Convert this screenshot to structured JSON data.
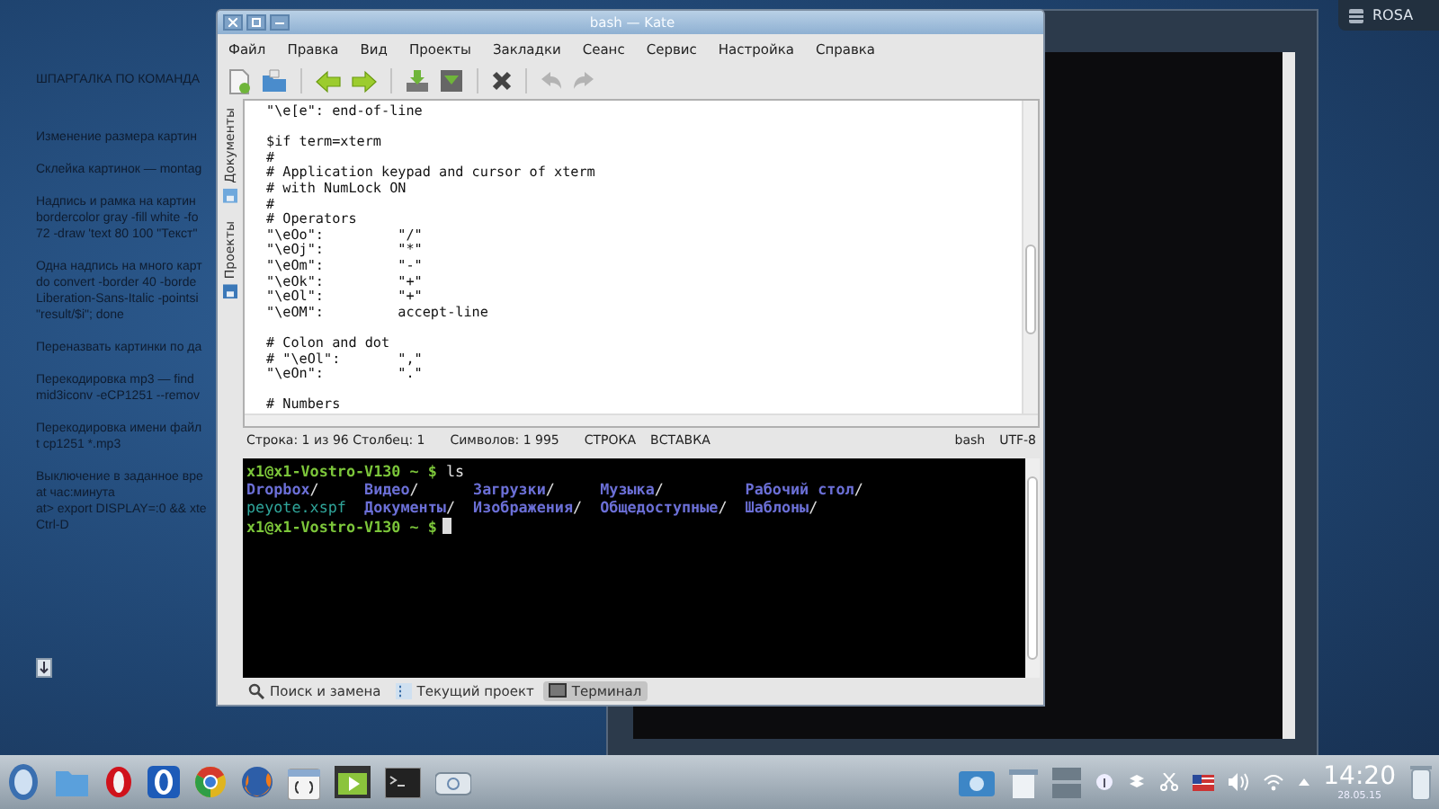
{
  "desktop": {
    "notes": [
      [
        "ШПАРГАЛКА ПО КОМАНДА"
      ],
      [
        "Изменение размера картин"
      ],
      [
        "Склейка картинок — montag"
      ],
      [
        "Надпись и рамка на картин",
        "bordercolor gray -fill white -fo",
        "72 -draw 'text 80 100 \"Текст\""
      ],
      [
        "Одна надпись на много карт",
        "do convert -border 40 -borde",
        "Liberation-Sans-Italic -pointsi",
        "\"result/$i\"; done"
      ],
      [
        "Переназвать картинки по да"
      ],
      [
        "Перекодировка mp3 — find",
        "mid3iconv -eCP1251 --remov"
      ],
      [
        "Перекодировка имени файл",
        "t cp1251 *.mp3"
      ],
      [
        "Выключение в заданное вре",
        "at час:минута",
        "at> export DISPLAY=:0 && xte",
        "Ctrl-D"
      ]
    ],
    "badge": "ROSA"
  },
  "kate": {
    "title": "bash — Kate",
    "menu": [
      "Файл",
      "Правка",
      "Вид",
      "Проекты",
      "Закладки",
      "Сеанс",
      "Сервис",
      "Настройка",
      "Справка"
    ],
    "toolbar": [
      {
        "kind": "new",
        "disabled": false
      },
      {
        "kind": "open",
        "disabled": false
      },
      {
        "kind": "separator"
      },
      {
        "kind": "back",
        "disabled": false
      },
      {
        "kind": "forward",
        "disabled": false
      },
      {
        "kind": "separator"
      },
      {
        "kind": "save",
        "disabled": false
      },
      {
        "kind": "save-as",
        "disabled": false
      },
      {
        "kind": "separator"
      },
      {
        "kind": "close",
        "disabled": false
      },
      {
        "kind": "separator"
      },
      {
        "kind": "undo",
        "disabled": true
      },
      {
        "kind": "redo",
        "disabled": true
      }
    ],
    "side_tabs": [
      {
        "label": "Документы",
        "selected": false
      },
      {
        "label": "Проекты",
        "selected": false
      }
    ],
    "editor": [
      [
        "\"\\e[e\": end-of-line"
      ],
      [
        "$if term=xterm",
        "#",
        "# Application keypad and cursor of xterm",
        "# with NumLock ON",
        "#",
        "# Operators",
        "\"\\eOo\":         \"/\"",
        "\"\\eOj\":         \"*\"",
        "\"\\eOm\":         \"-\"",
        "\"\\eOk\":         \"+\"",
        "\"\\eOl\":         \"+\"",
        "\"\\eOM\":         accept-line"
      ],
      [
        "# Colon and dot",
        "# \"\\eOl\":       \",\"",
        "\"\\eOn\":         \".\""
      ],
      [
        "# Numbers"
      ]
    ],
    "status": {
      "position": "Строка: 1 из 96 Столбец: 1",
      "chars": "Символов: 1 995",
      "modes": [
        "СТРОКА",
        "ВСТАВКА"
      ],
      "syntax": "bash",
      "encoding": "UTF-8"
    },
    "terminal": [
      {
        "kind": "command",
        "prompt": "x1@x1-Vostro-V130 ~ $",
        "command": "ls",
        "cursor": false
      },
      {
        "kind": "listing",
        "items": [
          {
            "name": "Dropbox",
            "suffix": "/",
            "color": "#6b6fd6"
          },
          {
            "name": "Видео",
            "suffix": "/",
            "color": "#6b6fd6"
          },
          {
            "name": "Загрузки",
            "suffix": "/",
            "color": "#6b6fd6"
          },
          {
            "name": "Музыка",
            "suffix": "/",
            "color": "#6b6fd6"
          },
          {
            "name": "Рабочий стол",
            "suffix": "/",
            "color": "#6b6fd6"
          }
        ]
      },
      {
        "kind": "listing",
        "items": [
          {
            "name": "peyote.xspf",
            "color": "#2fa59a"
          },
          {
            "name": "Документы",
            "suffix": "/",
            "color": "#6b6fd6"
          },
          {
            "name": "Изображения",
            "suffix": "/",
            "color": "#6b6fd6"
          },
          {
            "name": "Общедоступные",
            "suffix": "/",
            "color": "#6b6fd6"
          },
          {
            "name": "Шаблоны",
            "suffix": "/",
            "color": "#6b6fd6"
          }
        ]
      },
      {
        "kind": "command",
        "prompt": "x1@x1-Vostro-V130 ~ $",
        "cursor": true
      }
    ],
    "bottom_tabs": [
      {
        "label": "Поиск и замена",
        "kind": "search",
        "selected": false
      },
      {
        "label": "Текущий проект",
        "kind": "project",
        "selected": false
      },
      {
        "label": "Терминал",
        "kind": "terminal",
        "selected": true
      }
    ]
  },
  "taskbar": {
    "clock": "14:20",
    "date": "28.05.15"
  }
}
